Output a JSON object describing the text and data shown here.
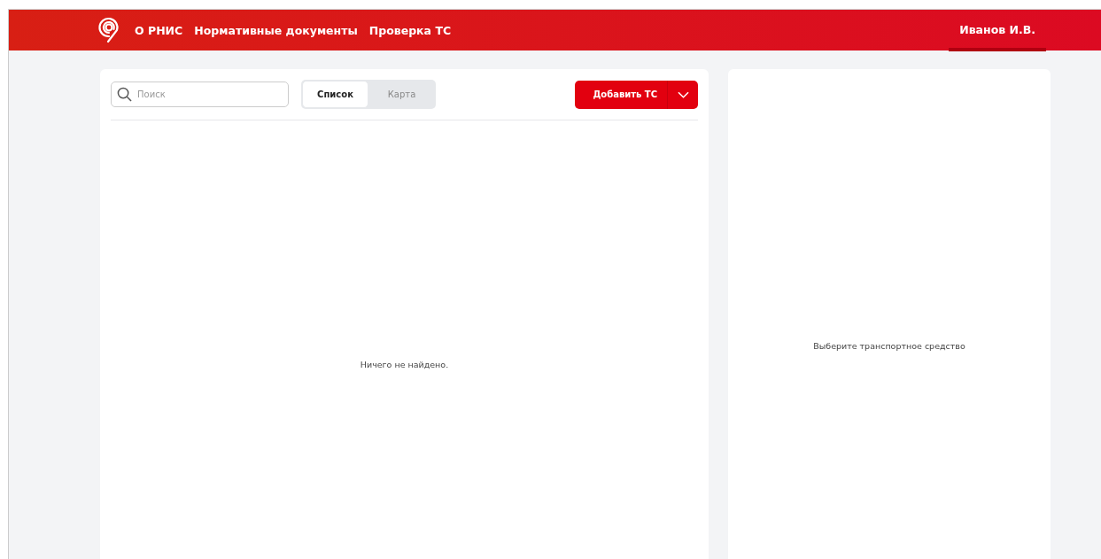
{
  "header": {
    "nav": [
      {
        "label": "О РНИС"
      },
      {
        "label": "Нормативные документы"
      },
      {
        "label": "Проверка ТС"
      }
    ],
    "user": {
      "name": "Иванов И.В.",
      "selected": true
    }
  },
  "list_panel": {
    "search": {
      "placeholder": "Поиск"
    },
    "view_tabs": [
      {
        "label": "Список",
        "selected": true
      },
      {
        "label": "Карта",
        "selected": false
      }
    ],
    "add_button": {
      "label": "Добавить ТС"
    },
    "empty_message": "Ничего не найдено."
  },
  "details_panel": {
    "empty_message": "Выберите транспортное средство"
  }
}
